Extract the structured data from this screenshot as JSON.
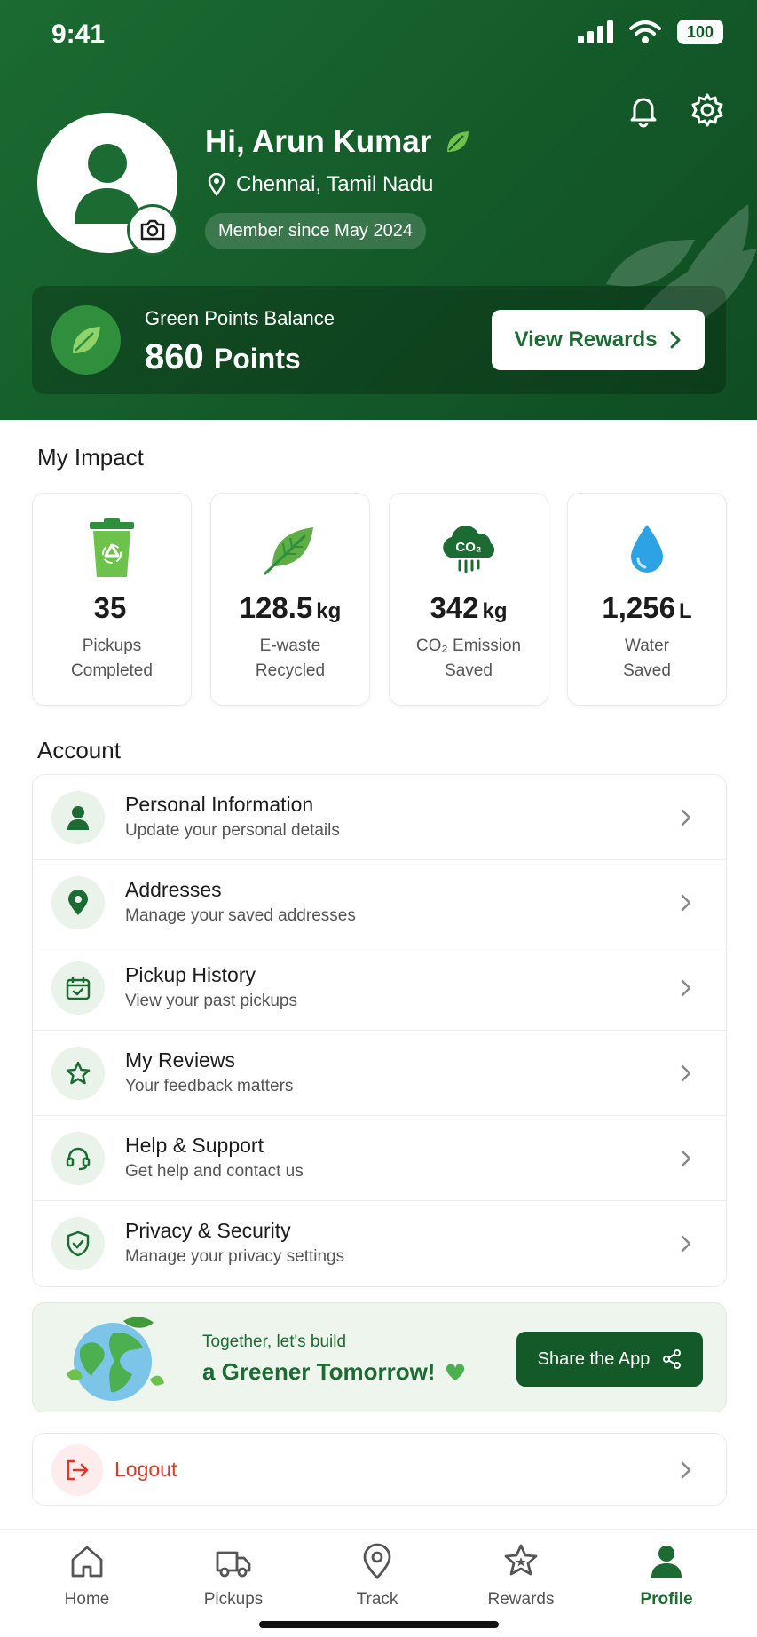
{
  "status_bar": {
    "time": "9:41",
    "battery": "100"
  },
  "header": {
    "greeting": "Hi, Arun Kumar",
    "location": "Chennai, Tamil Nadu",
    "member_since": "Member since May 2024",
    "icons": [
      "bell-icon",
      "gear-icon",
      "camera-icon",
      "leaf-icon",
      "location-pin-icon"
    ]
  },
  "points": {
    "label": "Green Points Balance",
    "value": "860",
    "unit": "Points",
    "button": "View Rewards"
  },
  "impact": {
    "title": "My Impact",
    "cards": [
      {
        "icon": "recycle-bin-icon",
        "value": "35",
        "unit": "",
        "label_line1": "Pickups",
        "label_line2": "Completed"
      },
      {
        "icon": "leaf-icon",
        "value": "128.5",
        "unit": "kg",
        "label_line1": "E-waste",
        "label_line2": "Recycled"
      },
      {
        "icon": "co2-cloud-icon",
        "value": "342",
        "unit": "kg",
        "label_line1": "CO₂ Emission",
        "label_line2": "Saved"
      },
      {
        "icon": "water-drop-icon",
        "value": "1,256",
        "unit": "L",
        "label_line1": "Water",
        "label_line2": "Saved"
      }
    ]
  },
  "account": {
    "title": "Account",
    "items": [
      {
        "icon": "person-icon",
        "title": "Personal Information",
        "subtitle": "Update your personal details"
      },
      {
        "icon": "location-pin-icon",
        "title": "Addresses",
        "subtitle": "Manage your saved addresses"
      },
      {
        "icon": "calendar-check-icon",
        "title": "Pickup History",
        "subtitle": "View your past pickups"
      },
      {
        "icon": "star-icon",
        "title": "My Reviews",
        "subtitle": "Your feedback matters"
      },
      {
        "icon": "headset-icon",
        "title": "Help & Support",
        "subtitle": "Get help and contact us"
      },
      {
        "icon": "shield-check-icon",
        "title": "Privacy & Security",
        "subtitle": "Manage your privacy settings"
      }
    ]
  },
  "banner": {
    "small": "Together, let's build",
    "big": "a Greener Tomorrow!",
    "button": "Share the App"
  },
  "logout": {
    "label": "Logout"
  },
  "nav": {
    "items": [
      {
        "label": "Home",
        "icon": "home-icon"
      },
      {
        "label": "Pickups",
        "icon": "truck-icon"
      },
      {
        "label": "Track",
        "icon": "location-pin-icon"
      },
      {
        "label": "Rewards",
        "icon": "star-badge-icon"
      },
      {
        "label": "Profile",
        "icon": "person-icon"
      }
    ],
    "active": "Profile"
  },
  "colors": {
    "primary": "#1b6b32",
    "dark": "#145a29",
    "danger": "#d93a2a",
    "accent_leaf": "#6cc24a"
  }
}
